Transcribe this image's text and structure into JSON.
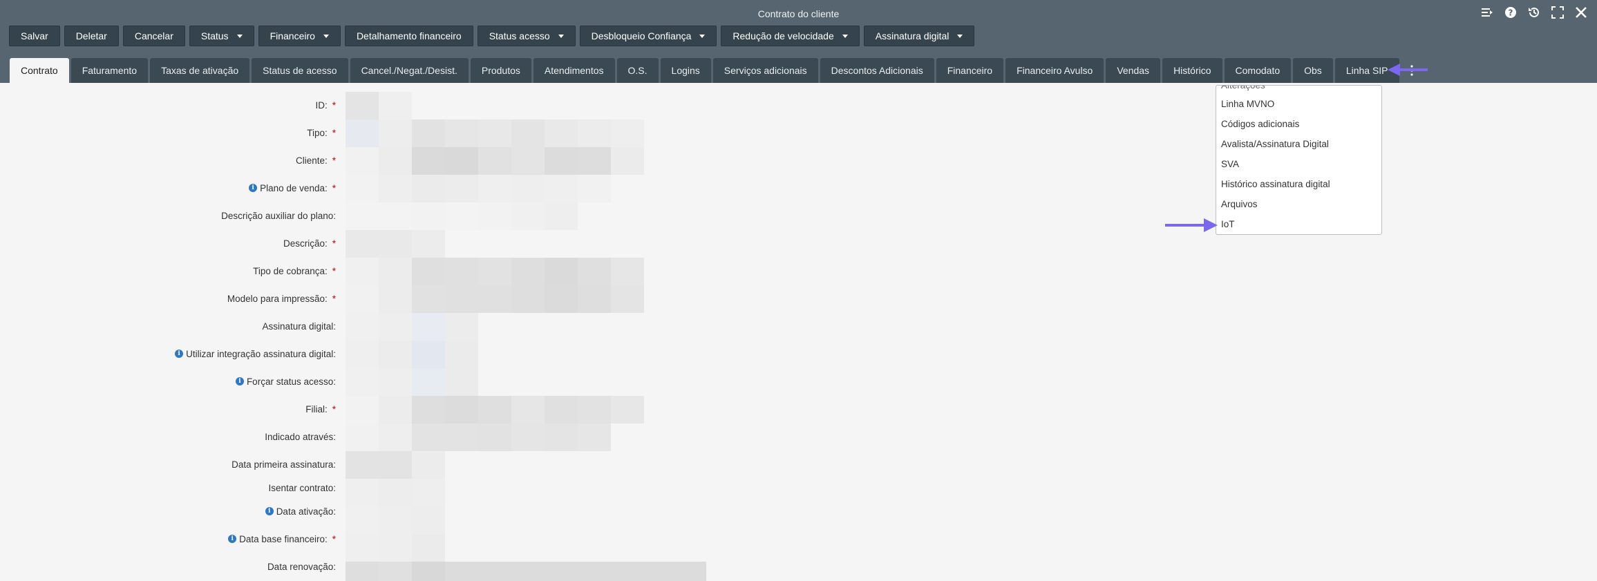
{
  "window": {
    "title": "Contrato do cliente"
  },
  "win_icons": [
    "reorder-icon",
    "help-icon",
    "history-icon",
    "maximize-icon",
    "close-icon"
  ],
  "toolbar": {
    "buttons": [
      {
        "label": "Salvar",
        "dropdown": false
      },
      {
        "label": "Deletar",
        "dropdown": false
      },
      {
        "label": "Cancelar",
        "dropdown": false
      },
      {
        "label": "Status",
        "dropdown": true
      },
      {
        "label": "Financeiro",
        "dropdown": true
      },
      {
        "label": "Detalhamento financeiro",
        "dropdown": false
      },
      {
        "label": "Status acesso",
        "dropdown": true
      },
      {
        "label": "Desbloqueio Confiança",
        "dropdown": true
      },
      {
        "label": "Redução de velocidade",
        "dropdown": true
      },
      {
        "label": "Assinatura digital",
        "dropdown": true
      }
    ]
  },
  "tabs": [
    {
      "label": "Contrato",
      "active": true
    },
    {
      "label": "Faturamento"
    },
    {
      "label": "Taxas de ativação"
    },
    {
      "label": "Status de acesso"
    },
    {
      "label": "Cancel./Negat./Desist."
    },
    {
      "label": "Produtos"
    },
    {
      "label": "Atendimentos"
    },
    {
      "label": "O.S."
    },
    {
      "label": "Logins"
    },
    {
      "label": "Serviços adicionais"
    },
    {
      "label": "Descontos Adicionais"
    },
    {
      "label": "Financeiro"
    },
    {
      "label": "Financeiro Avulso"
    },
    {
      "label": "Vendas"
    },
    {
      "label": "Histórico"
    },
    {
      "label": "Comodato"
    },
    {
      "label": "Obs"
    },
    {
      "label": "Linha SIP"
    }
  ],
  "form": {
    "fields": [
      {
        "label": "ID:",
        "required": true,
        "info": false
      },
      {
        "label": "Tipo:",
        "required": true,
        "info": false
      },
      {
        "label": "Cliente:",
        "required": true,
        "info": false
      },
      {
        "label": "Plano de venda:",
        "required": true,
        "info": true
      },
      {
        "label": "Descrição auxiliar do plano:",
        "required": false,
        "info": false
      },
      {
        "label": "Descrição:",
        "required": true,
        "info": false
      },
      {
        "label": "Tipo de cobrança:",
        "required": true,
        "info": false
      },
      {
        "label": "Modelo para impressão:",
        "required": true,
        "info": false
      },
      {
        "label": "Assinatura digital:",
        "required": false,
        "info": false
      },
      {
        "label": "Utilizar integração assinatura digital:",
        "required": false,
        "info": true
      },
      {
        "label": "Forçar status acesso:",
        "required": false,
        "info": true
      },
      {
        "label": "Filial:",
        "required": true,
        "info": false
      },
      {
        "label": "Indicado através:",
        "required": false,
        "info": false
      },
      {
        "label": "Data primeira assinatura:",
        "required": false,
        "info": false
      },
      {
        "label": "Isentar contrato:",
        "required": false,
        "info": false
      },
      {
        "label": "Data ativação:",
        "required": false,
        "info": true
      },
      {
        "label": "Data base financeiro:",
        "required": true,
        "info": true
      },
      {
        "label": "Data renovação:",
        "required": false,
        "info": false
      }
    ]
  },
  "more_menu": {
    "items": [
      "Alterações",
      "Linha MVNO",
      "Códigos adicionais",
      "Avalista/Assinatura Digital",
      "SVA",
      "Histórico assinatura digital",
      "Arquivos",
      "IoT"
    ]
  },
  "colors": {
    "accent_arrow": "#7b68ee",
    "required": "#d40000",
    "info": "#2c78c7",
    "titlebar": "#56656f",
    "button": "#34434c"
  }
}
